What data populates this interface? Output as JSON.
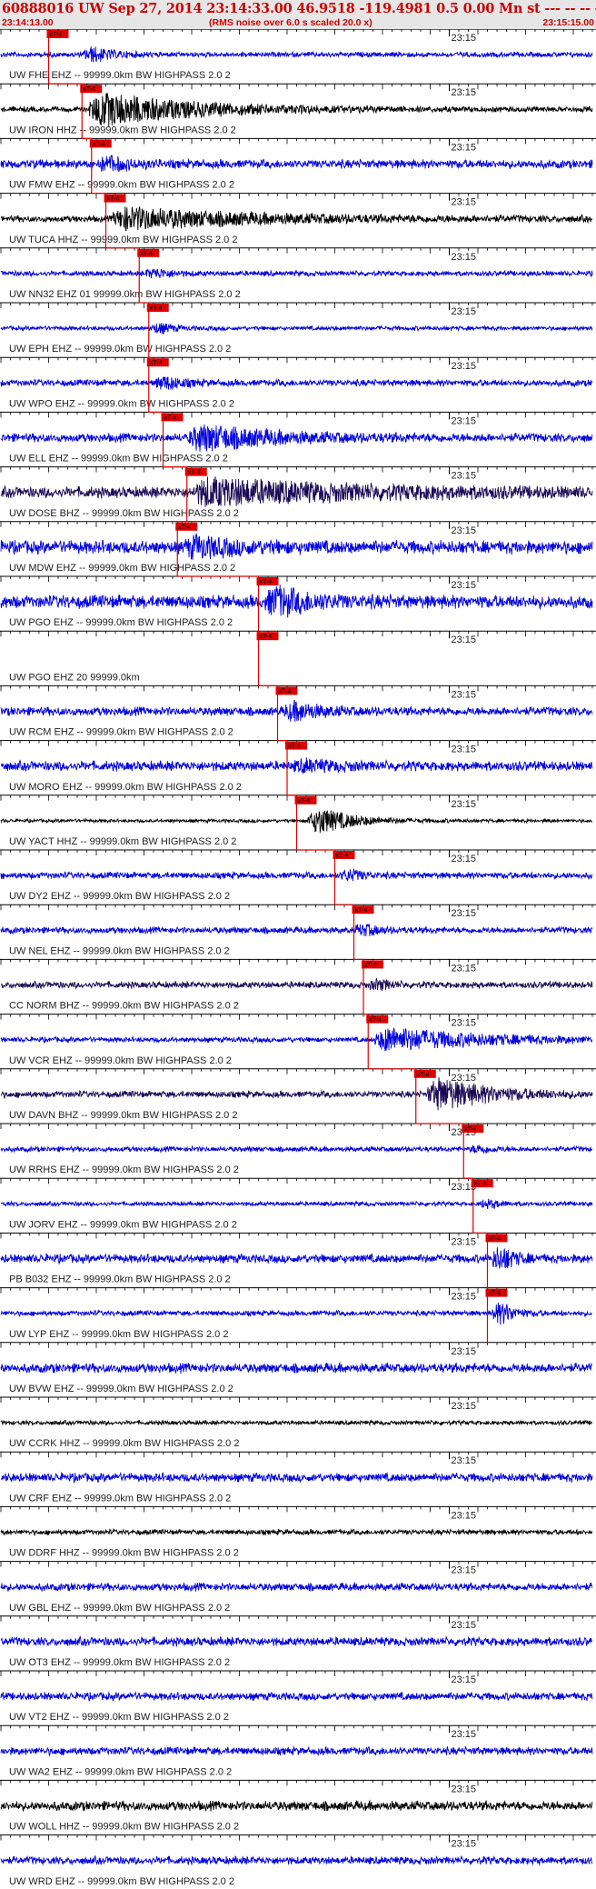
{
  "header": {
    "title": "60888016 UW Sep 27, 2014 23:14:33.00   46.9518 -119.4981  0.5 0.00 Mn st --- -- --  -1",
    "start_time": "23:14:13.00",
    "end_time": "23:15:15.00",
    "note": "(RMS noise over 6.0 s scaled 20.0 x)"
  },
  "chart_data": {
    "type": "line",
    "title": "60888016 UW Sep 27, 2014 23:14:33.00   46.9518 -119.4981  0.5 0.00 Mn st --- -- --  -1",
    "x_range": [
      "23:14:13.00",
      "23:15:15.00"
    ],
    "x_tick_label": "23:15",
    "pick_label": "xT-4",
    "grid": false,
    "colors": {
      "blue": "#0000dd",
      "black": "#000000",
      "navy": "#1a0a55",
      "pick": "#dd0000"
    },
    "traces": [
      {
        "label": "UW FHE EHZ -- 99999.0km BW  HIGHPASS  2.0  2",
        "color": "blue",
        "amp": 0.12,
        "pick_s": 5.0,
        "event_s": 9.0,
        "event_amp": 0.6,
        "dur": 4
      },
      {
        "label": "UW IRON HHZ -- 99999.0km BW  HIGHPASS  2.0  2",
        "color": "black",
        "amp": 0.12,
        "pick_s": 8.5,
        "event_s": 9.5,
        "event_amp": 1.0,
        "dur": 22
      },
      {
        "label": "UW FMW EHZ -- 99999.0km BW  HIGHPASS  2.0  2",
        "color": "blue",
        "amp": 0.2,
        "pick_s": 9.5,
        "event_s": 10.5,
        "event_amp": 0.5,
        "dur": 5
      },
      {
        "label": "UW TUCA HHZ -- 99999.0km BW  HIGHPASS  2.0  2",
        "color": "black",
        "amp": 0.15,
        "pick_s": 11.0,
        "event_s": 12.0,
        "event_amp": 0.6,
        "dur": 30
      },
      {
        "label": "UW NN32 EHZ 01 99999.0km BW  HIGHPASS  2.0  2",
        "color": "blue",
        "amp": 0.12,
        "pick_s": 14.5,
        "event_s": 15.5,
        "event_amp": 0.35,
        "dur": 4
      },
      {
        "label": "UW EPH EHZ -- 99999.0km BW  HIGHPASS  2.0  2",
        "color": "blue",
        "amp": 0.1,
        "pick_s": 15.5,
        "event_s": 16.0,
        "event_amp": 0.45,
        "dur": 3
      },
      {
        "label": "UW WPO EHZ -- 99999.0km BW  HIGHPASS  2.0  2",
        "color": "blue",
        "amp": 0.15,
        "pick_s": 15.5,
        "event_s": 16.5,
        "event_amp": 0.5,
        "dur": 4
      },
      {
        "label": "UW ELL EHZ -- 99999.0km BW  HIGHPASS  2.0  2",
        "color": "blue",
        "amp": 0.2,
        "pick_s": 17.0,
        "event_s": 20.0,
        "event_amp": 0.75,
        "dur": 16
      },
      {
        "label": "UW DOSE BHZ -- 99999.0km BW  HIGHPASS  2.0  2",
        "color": "navy",
        "amp": 0.25,
        "pick_s": 19.5,
        "event_s": 20.5,
        "event_amp": 0.7,
        "dur": 35
      },
      {
        "label": "UW MDW EHZ -- 99999.0km BW  HIGHPASS  2.0  2",
        "color": "blue",
        "amp": 0.3,
        "pick_s": 18.5,
        "event_s": 19.5,
        "event_amp": 0.55,
        "dur": 10
      },
      {
        "label": "UW PGO EHZ -- 99999.0km BW  HIGHPASS  2.0  2",
        "color": "blue",
        "amp": 0.3,
        "pick_s": 27.0,
        "event_s": 28.0,
        "event_amp": 0.9,
        "dur": 8
      },
      {
        "label": "UW PGO EHZ 20 99999.0km",
        "color": "blue",
        "amp": 0.0,
        "pick_s": 27.0,
        "event_s": 0,
        "event_amp": 0,
        "dur": 0
      },
      {
        "label": "UW RCM EHZ -- 99999.0km BW  HIGHPASS  2.0  2",
        "color": "blue",
        "amp": 0.2,
        "pick_s": 29.0,
        "event_s": 30.0,
        "event_amp": 0.6,
        "dur": 6
      },
      {
        "label": "UW MORO EHZ -- 99999.0km BW  HIGHPASS  2.0  2",
        "color": "blue",
        "amp": 0.22,
        "pick_s": 30.0,
        "event_s": 31.0,
        "event_amp": 0.3,
        "dur": 8
      },
      {
        "label": "UW YACT HHZ -- 99999.0km BW  HIGHPASS  2.0  2",
        "color": "black",
        "amp": 0.08,
        "pick_s": 31.0,
        "event_s": 32.5,
        "event_amp": 0.9,
        "dur": 8
      },
      {
        "label": "UW DY2 EHZ -- 99999.0km BW  HIGHPASS  2.0  2",
        "color": "blue",
        "amp": 0.15,
        "pick_s": 35.0,
        "event_s": 36.0,
        "event_amp": 0.45,
        "dur": 3
      },
      {
        "label": "UW NEL EHZ -- 99999.0km BW  HIGHPASS  2.0  2",
        "color": "blue",
        "amp": 0.15,
        "pick_s": 37.0,
        "event_s": 37.5,
        "event_amp": 0.45,
        "dur": 3
      },
      {
        "label": "CC NORM BHZ -- 99999.0km BW  HIGHPASS  2.0  2",
        "color": "navy",
        "amp": 0.15,
        "pick_s": 38.0,
        "event_s": 39.0,
        "event_amp": 0.4,
        "dur": 3
      },
      {
        "label": "UW VCR EHZ -- 99999.0km BW  HIGHPASS  2.0  2",
        "color": "blue",
        "amp": 0.12,
        "pick_s": 38.5,
        "event_s": 39.5,
        "event_amp": 0.7,
        "dur": 22
      },
      {
        "label": "UW DAVN BHZ -- 99999.0km BW  HIGHPASS  2.0  2",
        "color": "navy",
        "amp": 0.15,
        "pick_s": 43.5,
        "event_s": 45.0,
        "event_amp": 1.0,
        "dur": 12
      },
      {
        "label": "UW RRHS EHZ -- 99999.0km BW  HIGHPASS  2.0  2",
        "color": "blue",
        "amp": 0.12,
        "pick_s": 48.5,
        "event_s": 49.5,
        "event_amp": 0.3,
        "dur": 3
      },
      {
        "label": "UW JORV EHZ -- 99999.0km BW  HIGHPASS  2.0  2",
        "color": "blue",
        "amp": 0.1,
        "pick_s": 49.5,
        "event_s": 50.5,
        "event_amp": 0.35,
        "dur": 3
      },
      {
        "label": "PB B032 EHZ -- 99999.0km BW  HIGHPASS  2.0  2",
        "color": "blue",
        "amp": 0.2,
        "pick_s": 51.0,
        "event_s": 51.8,
        "event_amp": 1.0,
        "dur": 3
      },
      {
        "label": "UW LYP EHZ -- 99999.0km BW  HIGHPASS  2.0  2",
        "color": "blue",
        "amp": 0.12,
        "pick_s": 51.0,
        "event_s": 51.8,
        "event_amp": 1.0,
        "dur": 3
      },
      {
        "label": "UW BVW EHZ -- 99999.0km BW  HIGHPASS  2.0  2",
        "color": "blue",
        "amp": 0.22,
        "pick_s": null,
        "event_s": 0,
        "event_amp": 0,
        "dur": 0
      },
      {
        "label": "UW CCRK HHZ -- 99999.0km BW  HIGHPASS  2.0  2",
        "color": "black",
        "amp": 0.1,
        "pick_s": null,
        "event_s": 0,
        "event_amp": 0,
        "dur": 0
      },
      {
        "label": "UW CRF EHZ -- 99999.0km BW  HIGHPASS  2.0  2",
        "color": "blue",
        "amp": 0.2,
        "pick_s": null,
        "event_s": 0,
        "event_amp": 0,
        "dur": 0
      },
      {
        "label": "UW DDRF HHZ -- 99999.0km BW  HIGHPASS  2.0  2",
        "color": "black",
        "amp": 0.12,
        "pick_s": null,
        "event_s": 0,
        "event_amp": 0,
        "dur": 0
      },
      {
        "label": "UW GBL EHZ -- 99999.0km BW  HIGHPASS  2.0  2",
        "color": "blue",
        "amp": 0.18,
        "pick_s": null,
        "event_s": 0,
        "event_amp": 0,
        "dur": 0
      },
      {
        "label": "UW OT3 EHZ -- 99999.0km BW  HIGHPASS  2.0  2",
        "color": "blue",
        "amp": 0.2,
        "pick_s": null,
        "event_s": 0,
        "event_amp": 0,
        "dur": 0
      },
      {
        "label": "UW VT2 EHZ -- 99999.0km BW  HIGHPASS  2.0  2",
        "color": "blue",
        "amp": 0.18,
        "pick_s": null,
        "event_s": 0,
        "event_amp": 0,
        "dur": 0
      },
      {
        "label": "UW WA2 EHZ -- 99999.0km BW  HIGHPASS  2.0  2",
        "color": "blue",
        "amp": 0.18,
        "pick_s": null,
        "event_s": 0,
        "event_amp": 0,
        "dur": 0
      },
      {
        "label": "UW WOLL HHZ -- 99999.0km BW  HIGHPASS  2.0  2",
        "color": "black",
        "amp": 0.22,
        "pick_s": null,
        "event_s": 0,
        "event_amp": 0,
        "dur": 0
      },
      {
        "label": "UW WRD EHZ -- 99999.0km BW  HIGHPASS  2.0  2",
        "color": "blue",
        "amp": 0.18,
        "pick_s": null,
        "event_s": 0,
        "event_amp": 0,
        "dur": 0
      }
    ]
  }
}
